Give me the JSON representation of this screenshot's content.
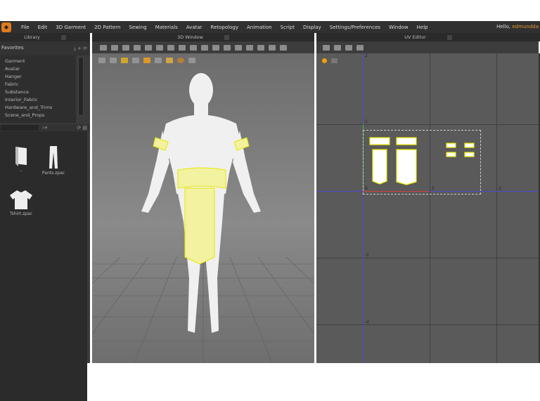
{
  "menubar": {
    "items": [
      "File",
      "Edit",
      "3D Garment",
      "2D Pattern",
      "Sewing",
      "Materials",
      "Avatar",
      "Retopology",
      "Animation",
      "Script",
      "Display",
      "Settings/Preferences",
      "Window",
      "Help"
    ],
    "greeting": "Hello,",
    "username": "edmundda",
    "logo_icon": "clo-logo-icon"
  },
  "panels": {
    "library": "Library",
    "view3d": "3D Window",
    "uv": "UV Editor"
  },
  "library": {
    "favorites_label": "Favorites",
    "favorites": [
      "Garment",
      "Avatar",
      "Hanger",
      "Fabric",
      "Substance",
      "Interior_Fabric",
      "Hardware_and_Trims",
      "Scene_and_Props"
    ],
    "files": [
      {
        "name": "..",
        "icon": "folder-icon"
      },
      {
        "name": "Pants.zpac",
        "icon": "pants-icon"
      },
      {
        "name": "Tshirt.zpac",
        "icon": "tshirt-icon"
      }
    ]
  },
  "uv_editor": {
    "v_labels": [
      "2",
      "1",
      "0",
      "-1",
      "-2"
    ],
    "u_labels": [
      "1",
      "2"
    ]
  },
  "colors": {
    "accent": "#e09a2a",
    "pattern_outline": "#f0f000",
    "u_axis": "#4a4ad0",
    "v_axis": "#d04040"
  }
}
